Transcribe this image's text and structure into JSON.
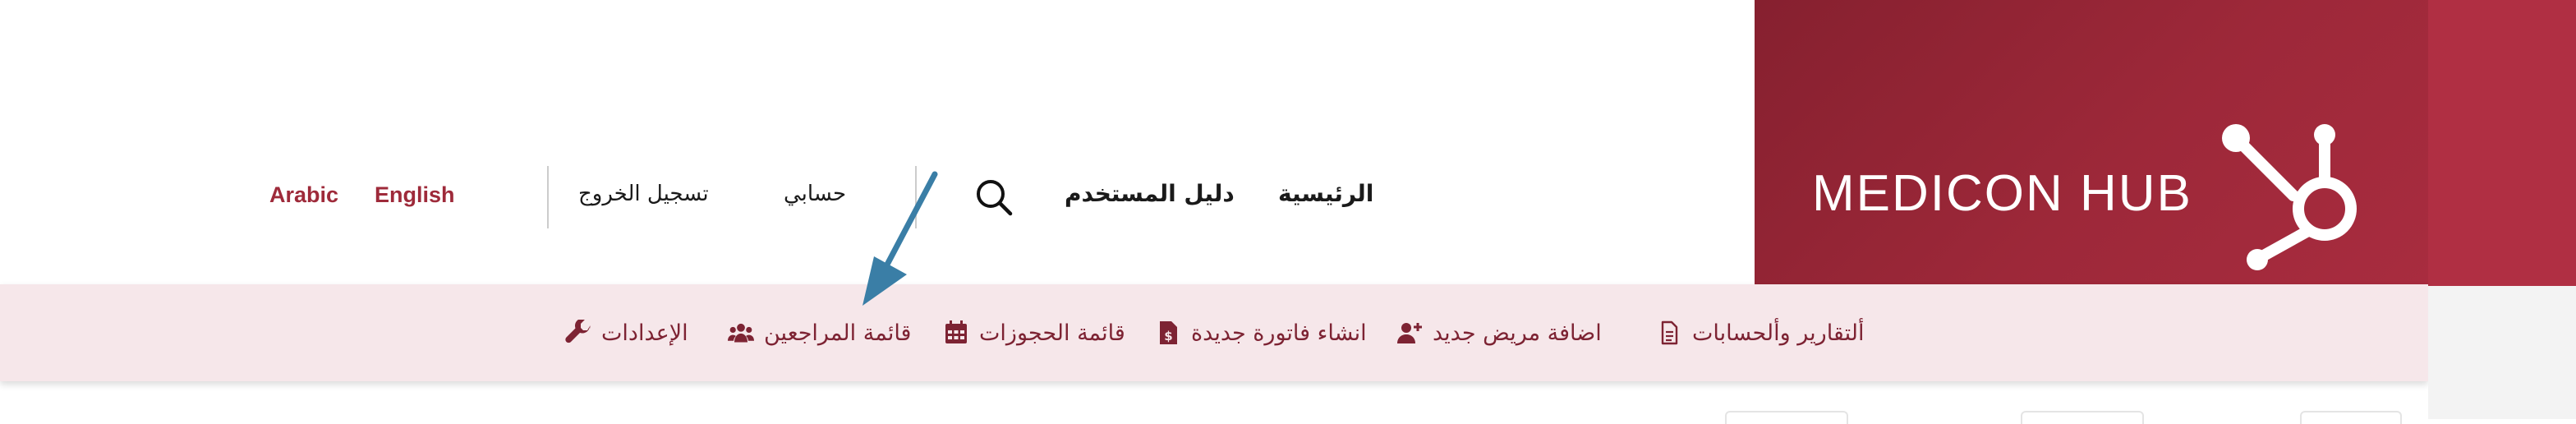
{
  "brand": {
    "name": "MEDICON HUB",
    "colors": {
      "primary": "#9d2839",
      "accent": "#b02f43"
    }
  },
  "header": {
    "home": "الرئيسية",
    "user_guide": "دليل المستخدم",
    "my_account": "حسابي",
    "logout": "تسجيل الخروج",
    "languages": [
      "English",
      "Arabic"
    ]
  },
  "subnav": {
    "items": [
      {
        "label": "ألتقارير وألحسابات",
        "icon": "document-icon"
      },
      {
        "label": "اضافة مريض جديد",
        "icon": "add-user-icon"
      },
      {
        "label": "انشاء فاتورة جديدة",
        "icon": "invoice-icon"
      },
      {
        "label": "قائمة الحجوزات",
        "icon": "calendar-icon"
      },
      {
        "label": "قائمة المراجعين",
        "icon": "users-icon"
      },
      {
        "label": "الإعدادات",
        "icon": "wrench-icon"
      }
    ]
  }
}
